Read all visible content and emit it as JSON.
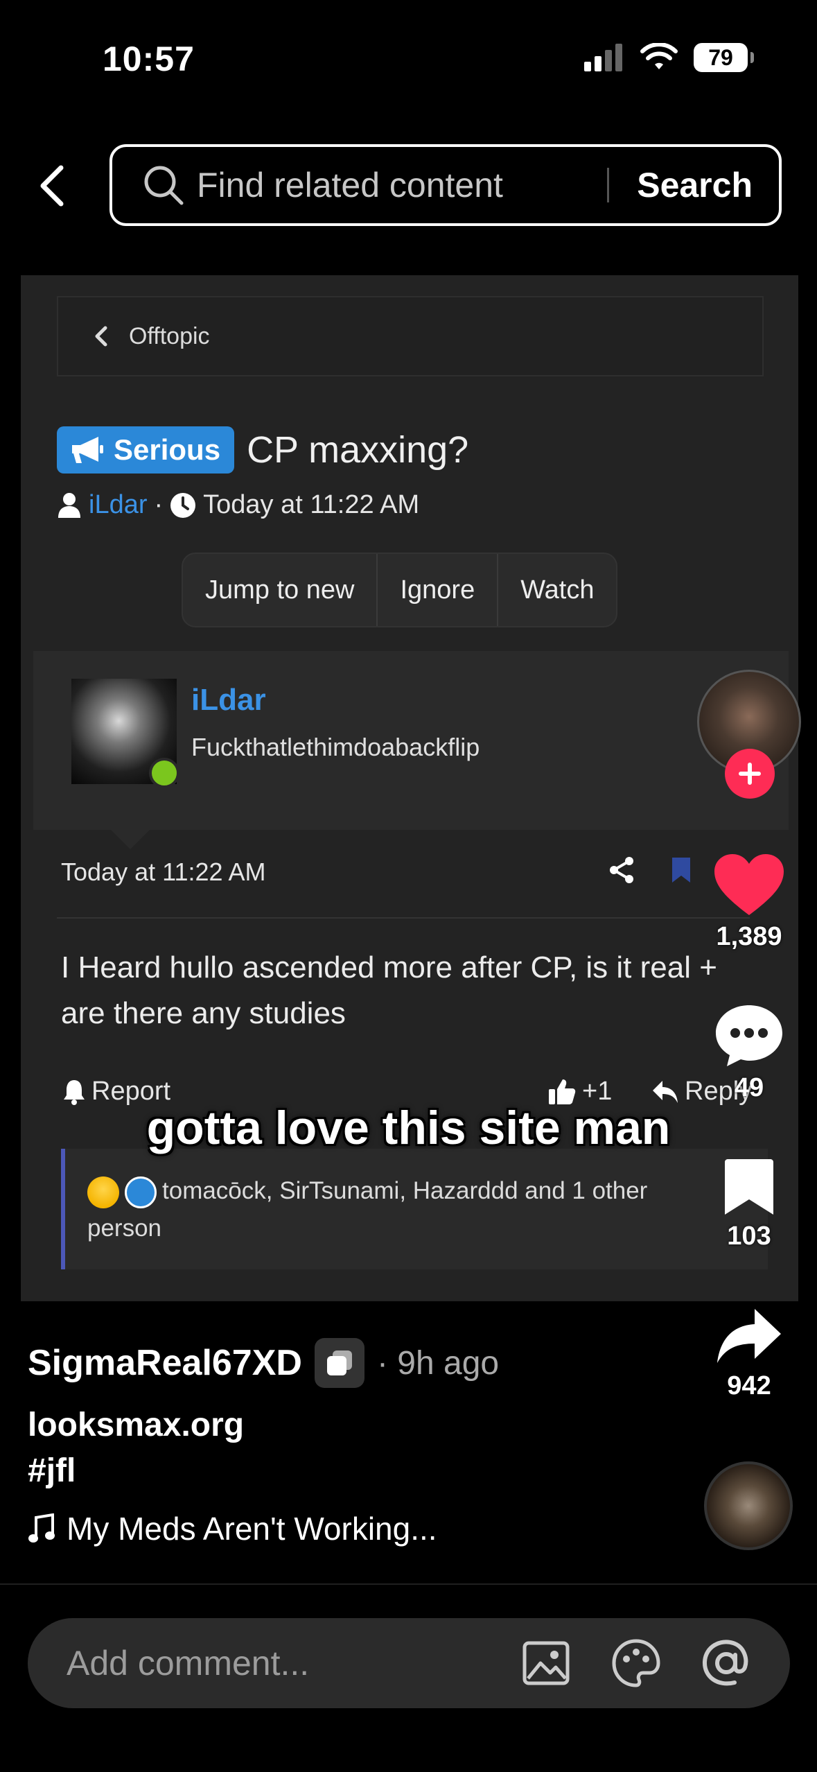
{
  "status_bar": {
    "time": "10:57",
    "battery": "79"
  },
  "search": {
    "placeholder": "Find related content",
    "button": "Search"
  },
  "forum": {
    "breadcrumb": "Offtopic",
    "prefix": "Serious",
    "title": "CP maxxing?",
    "author": "iLdar",
    "separator": "·",
    "date": "Today at 11:22 AM",
    "actions": [
      "Jump to new",
      "Ignore",
      "Watch"
    ],
    "poster": {
      "name": "iLdar",
      "user_title": "Fuckthatlethimdoabackflip"
    },
    "post_date": "Today at 11:22 AM",
    "body": "I Heard hullo ascended more after CP, is it real + are there any studies",
    "report": "Report",
    "like": "+1",
    "reply": "Reply",
    "reactions": "tomacōck, SirTsunami, Hazarddd and 1 other person"
  },
  "caption": "gotta love this site man",
  "rail": {
    "likes": "1,389",
    "comments": "49",
    "saves": "103",
    "shares": "942"
  },
  "video": {
    "username": "SigmaReal67XD",
    "time_ago": "· 9h ago",
    "line1": "looksmax.org",
    "line2": "#jfl",
    "music": "My Meds Aren't Working..."
  },
  "comment": {
    "placeholder": "Add comment..."
  },
  "colors": {
    "accent_blue": "#3b92e6",
    "like_red": "#fe2c55",
    "online_green": "#7bc61e",
    "prefix_blue": "#2b88d8"
  }
}
